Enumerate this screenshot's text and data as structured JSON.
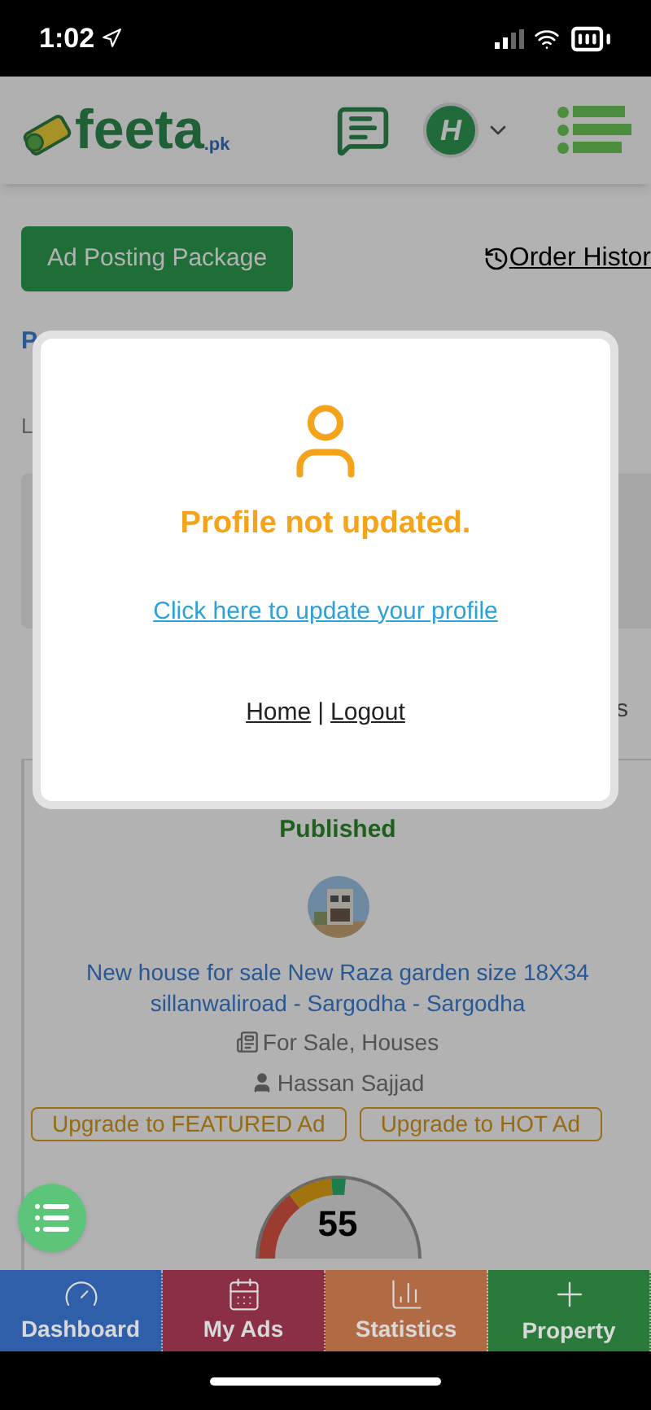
{
  "status_bar": {
    "time": "1:02"
  },
  "header": {
    "logo_text": "feeta",
    "logo_suffix": ".pk",
    "avatar_letter": "H"
  },
  "actions": {
    "package_button": "Ad Posting Package",
    "order_history": "Order Histor"
  },
  "stats": {
    "first_label": "P",
    "sublabel": "L"
  },
  "section": {
    "filter": "s"
  },
  "ad": {
    "status": "Published",
    "title": "New house for sale New Raza garden size 18X34 sillanwaliroad - Sargodha - Sargodha",
    "category": "For Sale, Houses",
    "author": "Hassan Sajjad",
    "upgrade_buttons": [
      "Upgrade to FEATURED Ad",
      "Upgrade to HOT Ad"
    ],
    "score": "55"
  },
  "modal": {
    "title": "Profile not updated.",
    "update_link": "Click here to update your profile",
    "links": [
      "Home",
      "Logout"
    ],
    "separator": "|"
  },
  "bottom_nav": [
    {
      "label": "Dashboard",
      "kind": "gauge",
      "color": "#2f5fa8"
    },
    {
      "label": "My Ads",
      "kind": "ads",
      "color": "#8b2f45"
    },
    {
      "label": "Statistics",
      "kind": "chart",
      "color": "#b06a44"
    },
    {
      "label": "Property",
      "kind": "plus",
      "color": "#2a7a3c"
    }
  ]
}
